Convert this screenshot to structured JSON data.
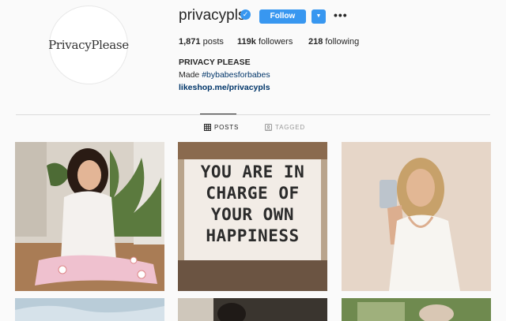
{
  "profile": {
    "username": "privacypls",
    "avatar_text": "PrivacyPlease",
    "follow_label": "Follow",
    "stats": {
      "posts": "1,871",
      "posts_label": "posts",
      "followers": "119k",
      "followers_label": "followers",
      "following": "218",
      "following_label": "following"
    },
    "bio_name": "PRIVACY PLEASE",
    "bio_prefix": "Made ",
    "bio_hashtag": "#bybabesforbabes",
    "link": "likeshop.me/privacypls"
  },
  "tabs": {
    "posts": "POSTS",
    "tagged": "TAGGED"
  },
  "grid": {
    "sign_lines": [
      "YOU ARE IN",
      "CHARGE OF",
      "YOUR OWN",
      "HAPPINESS"
    ]
  },
  "colors": {
    "accent": "#3897f0",
    "link": "#003569",
    "background": "#fafafa"
  }
}
